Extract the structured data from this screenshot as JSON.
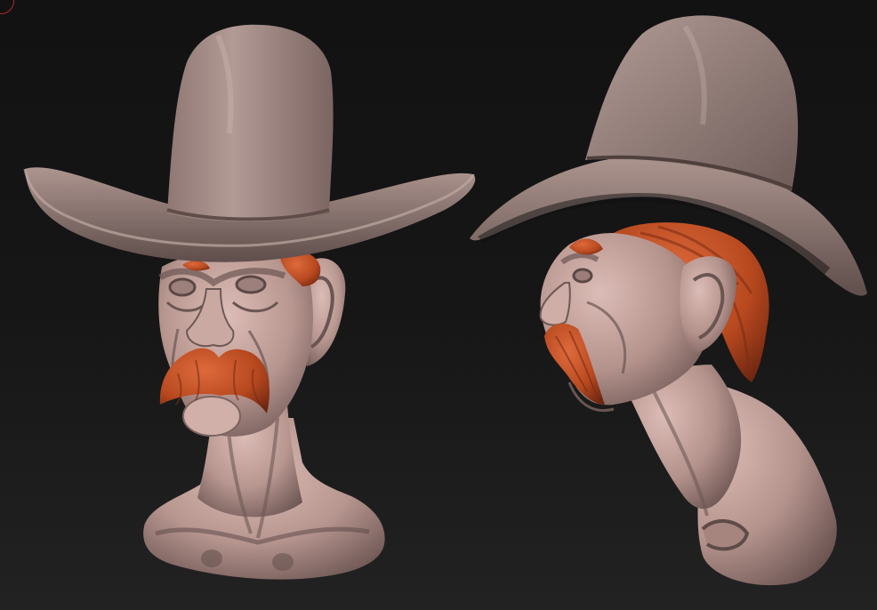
{
  "canvas": {
    "colors": {
      "background_top": "#131313",
      "background_bottom": "#1f1f1f",
      "skin": "#c7a59f",
      "skin_shadow": "#7c6360",
      "hat": "#a28984",
      "hat_shadow": "#5e4d4a",
      "hair": "#c4532c",
      "hair_shadow": "#7a2c14",
      "marker": "#b3262a"
    }
  },
  "views": [
    {
      "name": "front-view"
    },
    {
      "name": "side-view"
    }
  ]
}
